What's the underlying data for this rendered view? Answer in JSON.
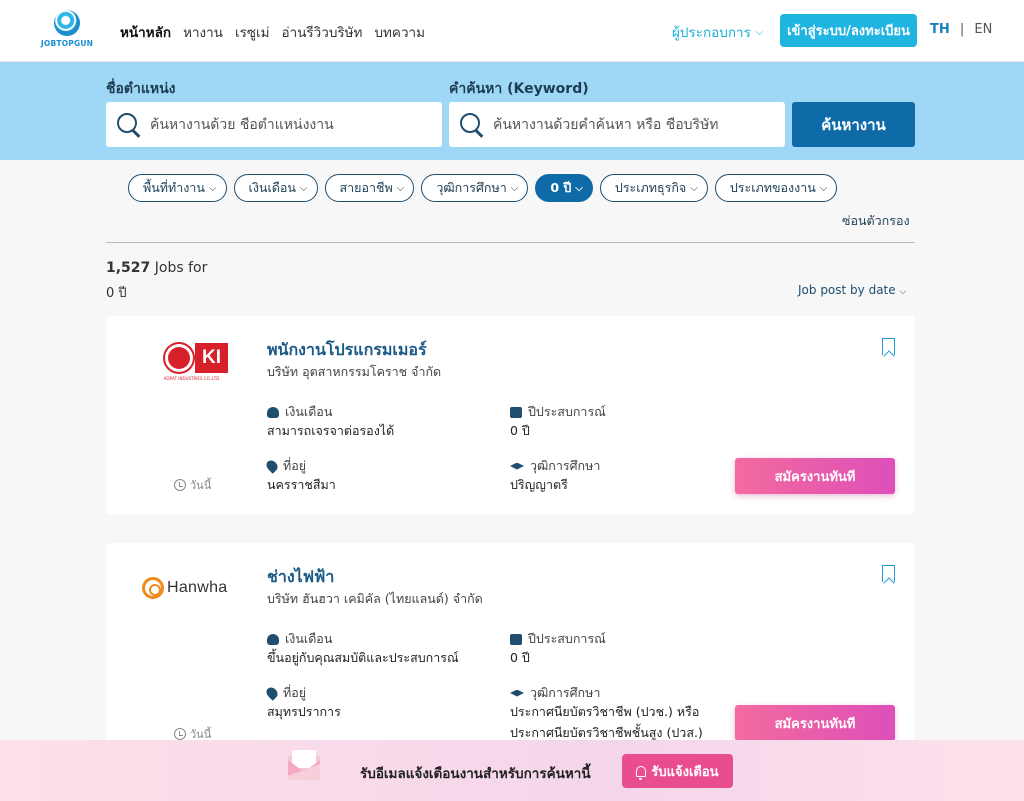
{
  "header": {
    "logo_text": "JOBTOPGUN",
    "nav": [
      "หน้าหลัก",
      "หางาน",
      "เรซูเม่",
      "อ่านรีวิวบริษัท",
      "บทความ"
    ],
    "employer_label": "ผู้ประกอบการ",
    "login_label": "เข้าสู่ระบบ/ลงทะเบียน",
    "lang_th": "TH",
    "lang_sep": "|",
    "lang_en": "EN"
  },
  "search": {
    "position_label": "ชื่อตำแหน่ง",
    "position_placeholder": "ค้นหางานด้วย ชื่อตำแหน่งงาน",
    "keyword_label": "คำค้นหา (Keyword)",
    "keyword_placeholder": "ค้นหางานด้วยคำค้นหา หรือ ชื่อบริษัท",
    "button_label": "ค้นหางาน"
  },
  "filters": {
    "chips": [
      {
        "label": "พื้นที่ทำงาน",
        "active": false
      },
      {
        "label": "เงินเดือน",
        "active": false
      },
      {
        "label": "สายอาชีพ",
        "active": false
      },
      {
        "label": "วุฒิการศึกษา",
        "active": false
      },
      {
        "label": "0 ปี",
        "active": true
      },
      {
        "label": "ประเภทธุรกิจ",
        "active": false
      },
      {
        "label": "ประเภทของงาน",
        "active": false
      }
    ],
    "hide_label": "ซ่อนตัวกรอง"
  },
  "results": {
    "count": "1,527",
    "count_suffix": " Jobs for",
    "query": "0 ปี",
    "sort_label": "Job post by date"
  },
  "jobs": [
    {
      "title": "พนักงานโปรแกรมเมอร์",
      "company": "บริษัท อุตสาหกรรมโคราช จำกัด",
      "logo_text": "KI",
      "logo_caption": "KORAT INDUSTRIES CO.,LTD.",
      "posted": "วันนี้",
      "salary_label": "เงินเดือน",
      "salary_value": "สามารถเจรจาต่อรองได้",
      "experience_label": "ปีประสบการณ์",
      "experience_value": "0 ปี",
      "location_label": "ที่อยู่",
      "location_value": "นครราชสีมา",
      "education_label": "วุฒิการศึกษา",
      "education_value": [
        "ปริญญาตรี"
      ],
      "apply_label": "สมัครงานทันที"
    },
    {
      "title": "ช่างไฟฟ้า",
      "company": "บริษัท ฮันฮวา เคมิคัล (ไทยแลนด์) จำกัด",
      "logo_text": "Hanwha",
      "posted": "วันนี้",
      "salary_label": "เงินเดือน",
      "salary_value": "ขึ้นอยู่กับคุณสมบัติและประสบการณ์",
      "experience_label": "ปีประสบการณ์",
      "experience_value": "0 ปี",
      "location_label": "ที่อยู่",
      "location_value": "สมุทรปราการ",
      "education_label": "วุฒิการศึกษา",
      "education_value": [
        "ประกาศนียบัตรวิชาชีพ (ปวช.) หรือ",
        "ประกาศนียบัตรวิชาชีพชั้นสูง (ปวส.)"
      ],
      "apply_label": "สมัครงานทันที"
    }
  ],
  "banner": {
    "text": "รับอีเมลแจ้งเตือนงานสำหรับการค้นหานี้",
    "button_label": "รับแจ้งเตือน"
  },
  "colors": {
    "primary": "#0f6aa8",
    "accent": "#20b4e0",
    "search_band": "#9fd8f6",
    "apply": "#e85aa8"
  }
}
